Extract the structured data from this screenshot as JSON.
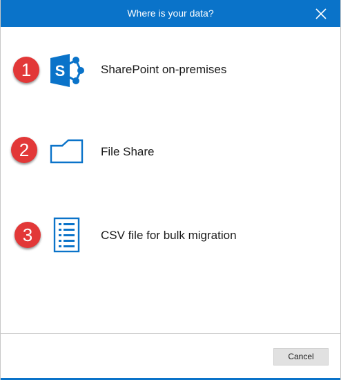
{
  "dialog": {
    "title": "Where is your data?",
    "close_icon": "close-icon",
    "accent_color": "#0a73c9"
  },
  "options": [
    {
      "number": "1",
      "label": "SharePoint on-premises",
      "icon": "sharepoint-icon"
    },
    {
      "number": "2",
      "label": "File Share",
      "icon": "folder-icon"
    },
    {
      "number": "3",
      "label": "CSV file for bulk migration",
      "icon": "document-list-icon"
    }
  ],
  "footer": {
    "cancel_label": "Cancel"
  },
  "colors": {
    "badge": "#e23838",
    "icon": "#0a73c9"
  }
}
